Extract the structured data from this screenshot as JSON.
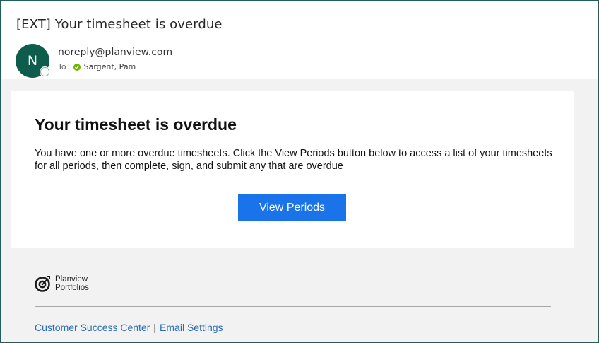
{
  "email": {
    "subject": "[EXT] Your timesheet is overdue",
    "avatar_initial": "N",
    "sender": "noreply@planview.com",
    "to_label": "To",
    "recipient": "Sargent, Pam"
  },
  "content": {
    "heading": "Your timesheet is overdue",
    "message": "You have one or more overdue timesheets. Click the View Periods button below to access a list of your timesheets for all periods, then complete, sign, and submit any that are overdue",
    "button_label": "View Periods"
  },
  "footer": {
    "logo_line1": "Planview",
    "logo_line2": "Portfolios",
    "link1": "Customer Success Center",
    "separator": "|",
    "link2": "Email Settings"
  },
  "colors": {
    "avatar": "#0d5c4c",
    "button": "#1a73e8",
    "link": "#2a6db3",
    "frame_border": "#1f5f5a"
  }
}
